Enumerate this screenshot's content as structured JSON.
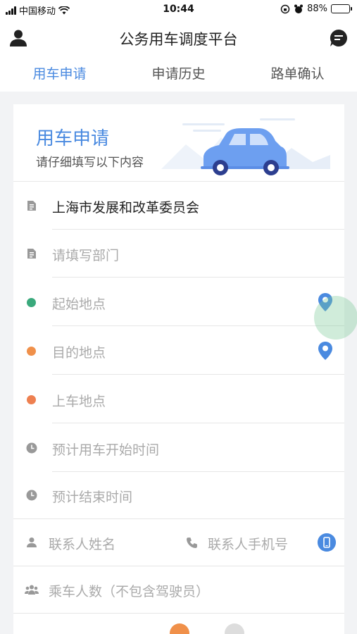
{
  "status_bar": {
    "carrier": "中国移动",
    "time": "10:44",
    "battery": "88%",
    "battery_level": 0.88
  },
  "header": {
    "title": "公务用车调度平台"
  },
  "tabs": [
    {
      "label": "用车申请",
      "active": true
    },
    {
      "label": "申请历史",
      "active": false
    },
    {
      "label": "路单确认",
      "active": false
    }
  ],
  "banner": {
    "title": "用车申请",
    "subtitle": "请仔细填写以下内容"
  },
  "form": {
    "organization": "上海市发展和改革委员会",
    "department_placeholder": "请填写部门",
    "start_location_placeholder": "起始地点",
    "destination_placeholder": "目的地点",
    "pickup_placeholder": "上车地点",
    "start_time_placeholder": "预计用车开始时间",
    "end_time_placeholder": "预计结束时间",
    "contact_name_placeholder": "联系人姓名",
    "contact_phone_placeholder": "联系人手机号",
    "passengers_placeholder": "乘车人数（不包含驾驶员）"
  },
  "colors": {
    "accent": "#4a8ae0",
    "green_dot": "#3aa97c",
    "orange_dot": "#f0904a"
  },
  "icons": {
    "user": "user-icon",
    "chat": "chat-icon",
    "document": "document-icon",
    "clock": "clock-icon",
    "person": "person-icon",
    "phone": "phone-icon",
    "group": "group-icon",
    "location_pin": "location-pin-icon",
    "mobile": "mobile-icon"
  }
}
